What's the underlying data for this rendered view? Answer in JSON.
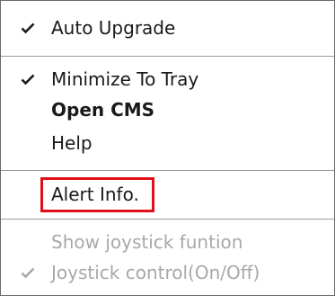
{
  "menu": {
    "items": [
      {
        "label": "Auto Upgrade",
        "checked": true,
        "bold": false,
        "disabled": false
      },
      {
        "label": "Minimize To Tray",
        "checked": true,
        "bold": false,
        "disabled": false
      },
      {
        "label": "Open CMS",
        "checked": false,
        "bold": true,
        "disabled": false
      },
      {
        "label": "Help",
        "checked": false,
        "bold": false,
        "disabled": false
      },
      {
        "label": "Alert Info.",
        "checked": false,
        "bold": false,
        "disabled": false,
        "highlighted": true
      },
      {
        "label": "Show joystick funtion",
        "checked": false,
        "bold": false,
        "disabled": true
      },
      {
        "label": "Joystick control(On/Off)",
        "checked": true,
        "bold": false,
        "disabled": true
      }
    ]
  },
  "icons": {
    "check": "checkmark-icon"
  },
  "colors": {
    "text": "#1a1a1a",
    "disabled_text": "#a8a8a8",
    "separator": "#9a9a9a",
    "highlight_border": "#e0101a",
    "background": "#ffffff"
  }
}
